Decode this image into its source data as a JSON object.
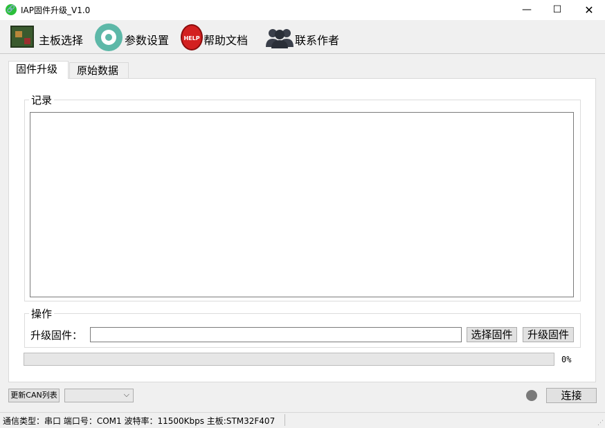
{
  "window": {
    "title": "IAP固件升级_V1.0",
    "icon_glyph": "🔗",
    "minimize": "—",
    "maximize": "☐",
    "close": "✕"
  },
  "toolbar": {
    "board_label": "主板选择",
    "params_label": "参数设置",
    "help_label": "帮助文档",
    "help_icon_text": "HELP",
    "author_label": "联系作者"
  },
  "tabs": [
    {
      "label": "固件升级",
      "active": true
    },
    {
      "label": "原始数据",
      "active": false
    }
  ],
  "log_group": {
    "legend": "记录"
  },
  "op_group": {
    "legend": "操作",
    "firmware_label": "升级固件：",
    "firmware_value": "",
    "select_button": "选择固件",
    "upgrade_button": "升级固件"
  },
  "progress": {
    "fraction": 0.0,
    "text": "0%"
  },
  "bottom": {
    "refresh_button": "更新CAN列表",
    "can_select_value": "",
    "connect_button": "连接",
    "status_dot_color": "#7a7a7a"
  },
  "statusbar": {
    "text": "通信类型：串口 端口号：COM1 波特率：11500Kbps 主板:STM32F407"
  }
}
